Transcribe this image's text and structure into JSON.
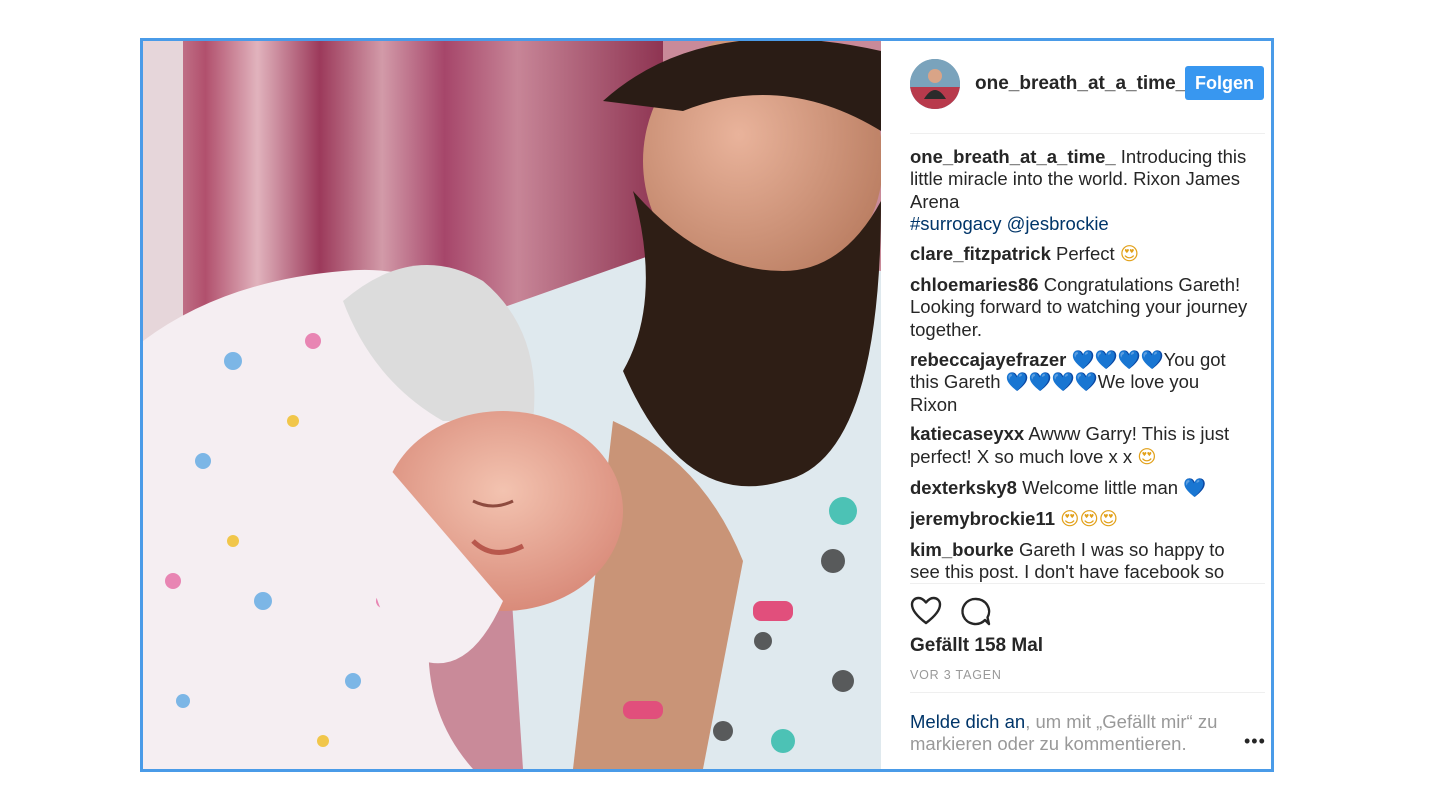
{
  "post": {
    "username": "one_breath_at_a_time_",
    "follow_label": "Folgen",
    "photo_icon": "photo-image",
    "caption": {
      "user": "one_breath_at_a_time_",
      "text": " Introducing this little miracle into the world. Rixon James Arena",
      "tags": "#surrogacy @jesbrockie"
    },
    "comments": [
      {
        "user": "clare_fitzpatrick",
        "text": " Perfect ",
        "emoji": "😍"
      },
      {
        "user": "chloemaries86",
        "text": " Congratulations Gareth! Looking forward to watching your journey together.",
        "emoji": ""
      },
      {
        "user": "rebeccajayefrazer",
        "text": " 💙💙💙💙You got this Gareth 💙💙💙💙We love you Rixon",
        "emoji": ""
      },
      {
        "user": "katiecaseyxx",
        "text": " Awww Garry! This is just perfect! X so much love x x ",
        "emoji": "😍"
      },
      {
        "user": "dexterksky8",
        "text": " Welcome little man ",
        "emoji": "💙"
      },
      {
        "user": "jeremybrockie11",
        "text": " ",
        "emoji": "😍😍😍"
      },
      {
        "user": "kim_bourke",
        "text": " Gareth I was so happy to see this post. I don't have facebook so I'm so glad I can keep updated with little Rixon and you",
        "emoji": ""
      }
    ],
    "likes": "Gefällt 158 Mal",
    "timestamp": "VOR 3 TAGEN",
    "login_link": "Melde dich an",
    "login_text": ", um mit „Gefällt mir“ zu markieren oder zu kommentieren.",
    "more_label": "•••",
    "icons": {
      "like": "heart-icon",
      "comment": "comment-icon",
      "more": "more-options-icon"
    },
    "colors": {
      "accent": "#3897f0",
      "frame": "#4a9be8",
      "link": "#003569",
      "muted": "#999999"
    }
  }
}
